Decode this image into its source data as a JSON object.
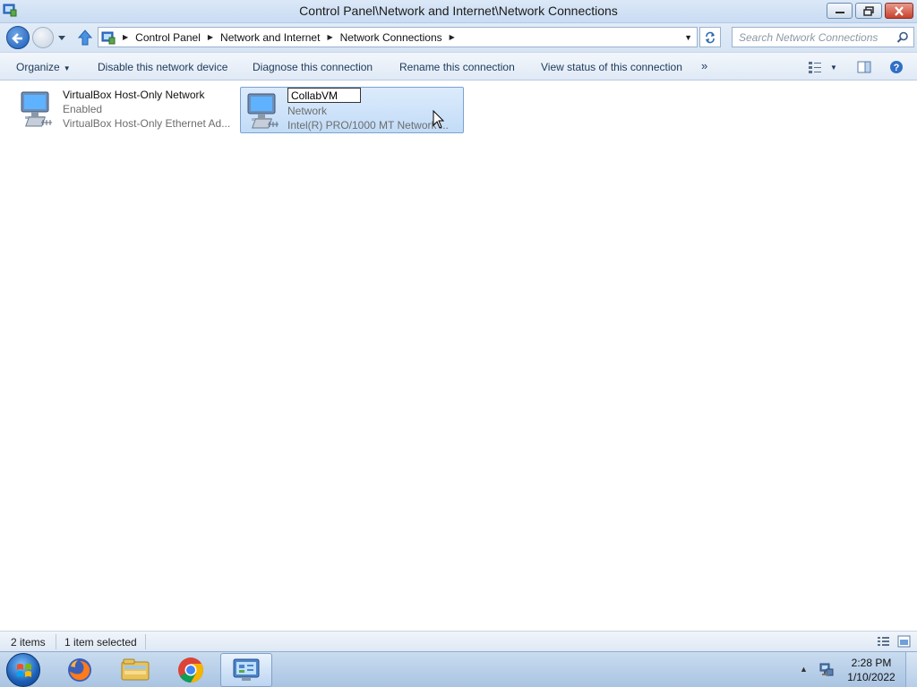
{
  "window": {
    "title": "Control Panel\\Network and Internet\\Network Connections"
  },
  "address": {
    "breadcrumbs": [
      "Control Panel",
      "Network and Internet",
      "Network Connections"
    ],
    "search_placeholder": "Search Network Connections"
  },
  "toolbar": {
    "organize": "Organize",
    "disable": "Disable this network device",
    "diagnose": "Diagnose this connection",
    "rename": "Rename this connection",
    "view_status": "View status of this connection",
    "more": "»"
  },
  "items": [
    {
      "name": "VirtualBox Host-Only Network",
      "status": "Enabled",
      "device": "VirtualBox Host-Only Ethernet Ad..."
    },
    {
      "name": "CollabVM",
      "status": "Network",
      "device": "Intel(R) PRO/1000 MT Network ..."
    }
  ],
  "status_bar": {
    "count": "2 items",
    "selected": "1 item selected"
  },
  "taskbar": {
    "time": "2:28 PM",
    "date": "1/10/2022",
    "apps": [
      "firefox-icon",
      "file-explorer-icon",
      "chrome-icon",
      "network-connections-icon"
    ]
  },
  "colors": {
    "selection": "#cfe3fa",
    "toolbar_text": "#1e395b"
  }
}
